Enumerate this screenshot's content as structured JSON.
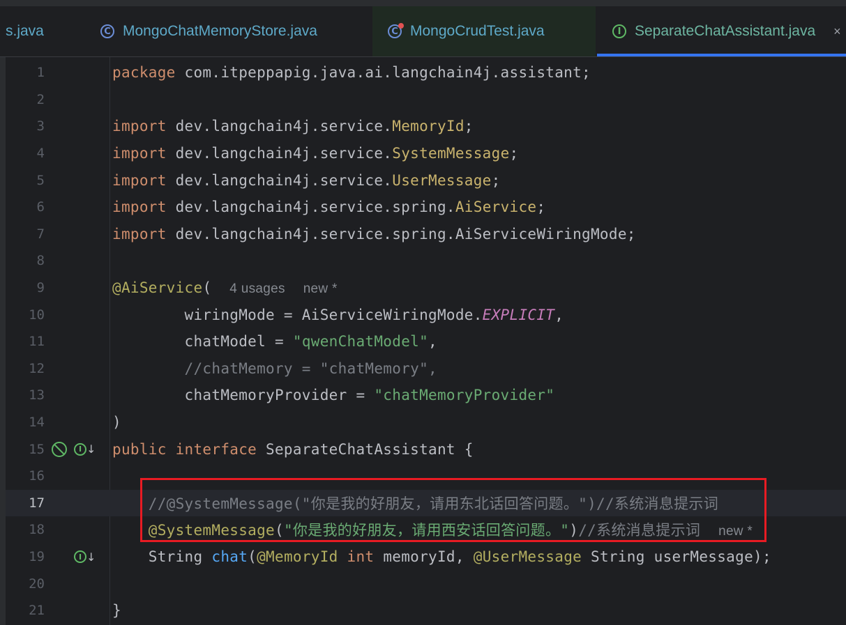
{
  "tabs": [
    {
      "label": "s.java",
      "icon": "",
      "active": false
    },
    {
      "label": "MongoChatMemoryStore.java",
      "icon": "class-icon",
      "active": false
    },
    {
      "label": "MongoCrudTest.java",
      "icon": "test-class-icon",
      "active": false
    },
    {
      "label": "SeparateChatAssistant.java",
      "icon": "interface-icon",
      "active": true,
      "close": "×"
    }
  ],
  "editor": {
    "current_line": 17,
    "line_numbers": [
      "1",
      "2",
      "3",
      "4",
      "5",
      "6",
      "7",
      "8",
      "9",
      "10",
      "11",
      "12",
      "13",
      "14",
      "15",
      "16",
      "17",
      "18",
      "19",
      "20",
      "21"
    ],
    "lines": {
      "l1": {
        "a": "package ",
        "b": "com.itpeppapig.java.ai.langchain4j.assistant;"
      },
      "l3": {
        "a": "import ",
        "b": "dev.langchain4j.service.",
        "c": "MemoryId",
        "d": ";"
      },
      "l4": {
        "a": "import ",
        "b": "dev.langchain4j.service.",
        "c": "SystemMessage",
        "d": ";"
      },
      "l5": {
        "a": "import ",
        "b": "dev.langchain4j.service.",
        "c": "UserMessage",
        "d": ";"
      },
      "l6": {
        "a": "import ",
        "b": "dev.langchain4j.service.spring.",
        "c": "AiService",
        "d": ";"
      },
      "l7": {
        "a": "import ",
        "b": "dev.langchain4j.service.spring.AiServiceWiringMode;"
      },
      "l9": {
        "a": "@AiService",
        "b": "(",
        "hint1": "4 usages",
        "hint2": "new *"
      },
      "l10": {
        "a": "        wiringMode = AiServiceWiringMode.",
        "b": "EXPLICIT",
        "c": ","
      },
      "l11": {
        "a": "        chatModel = ",
        "b": "\"qwenChatModel\"",
        "c": ","
      },
      "l12": {
        "a": "        //chatMemory = \"chatMemory\","
      },
      "l13": {
        "a": "        chatMemoryProvider = ",
        "b": "\"chatMemoryProvider\""
      },
      "l14": {
        "a": ")"
      },
      "l15": {
        "a": "public interface ",
        "b": "SeparateChatAssistant {"
      },
      "l17": {
        "a": "    //@SystemMessage(\"你是我的好朋友，请用东北话回答问题。\")//系统消息提示词"
      },
      "l18": {
        "a": "    @SystemMessage",
        "b": "(",
        "c": "\"你是我的好朋友，请用西安话回答问题。\"",
        "d": ")",
        "e": "//系统消息提示词",
        "hint": "new *"
      },
      "l19": {
        "a": "    String ",
        "b": "chat",
        "c": "(",
        "d": "@MemoryId ",
        "e": "int ",
        "f": "memoryId, ",
        "g": "@UserMessage ",
        "h": "String userMessage);"
      },
      "l21": {
        "a": "}"
      }
    },
    "gutter_icons": [
      "spring-bean-icon",
      "implemented-interface-icon"
    ],
    "gutter_glyphs": {
      "impl": "I",
      "arrow": "↓"
    }
  },
  "highlight_box_color": "#e81b23"
}
